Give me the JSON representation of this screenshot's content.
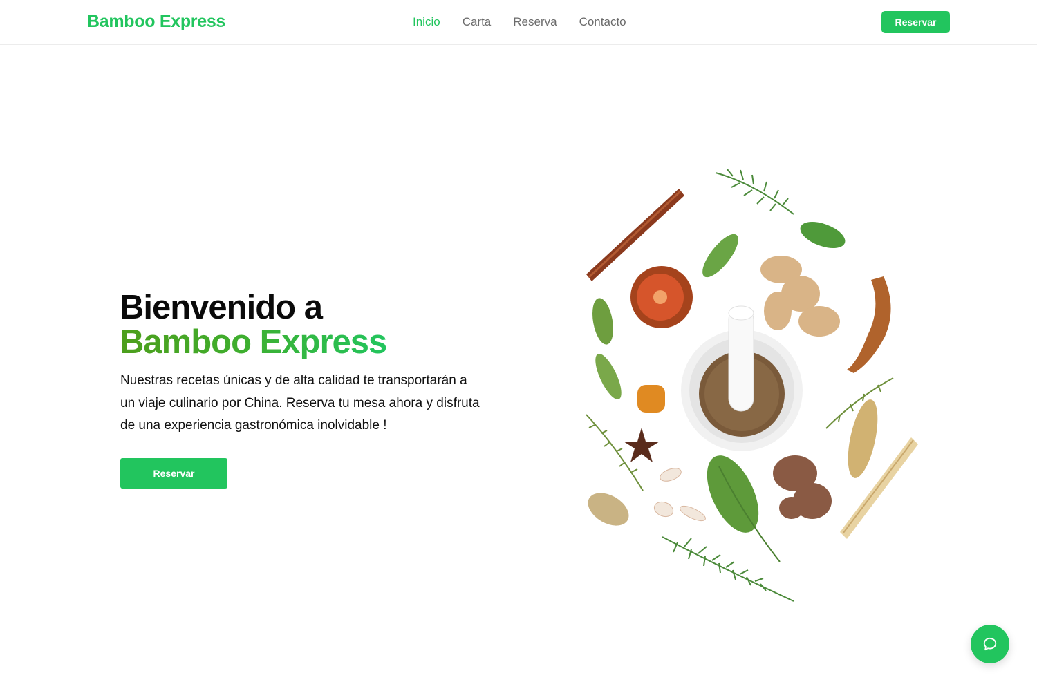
{
  "header": {
    "logo": "Bamboo Express",
    "nav": [
      {
        "label": "Inicio",
        "active": true
      },
      {
        "label": "Carta",
        "active": false
      },
      {
        "label": "Reserva",
        "active": false
      },
      {
        "label": "Contacto",
        "active": false
      }
    ],
    "cta_label": "Reservar"
  },
  "hero": {
    "title_line1": "Bienvenido a",
    "title_line2": "Bamboo Express",
    "description": "Nuestras recetas únicas y de alta calidad te transportarán a un viaje culinario por China. Reserva tu mesa ahora y disfruta de una experiencia gastronómica inolvidable !",
    "cta_label": "Reservar",
    "image": "spices-mortar-herbs"
  },
  "chat_button": {
    "icon": "chat-bubble-icon"
  },
  "colors": {
    "accent": "#22c55e",
    "gradient_start": "#4d9e1c",
    "nav_text": "#6b6b6b"
  }
}
